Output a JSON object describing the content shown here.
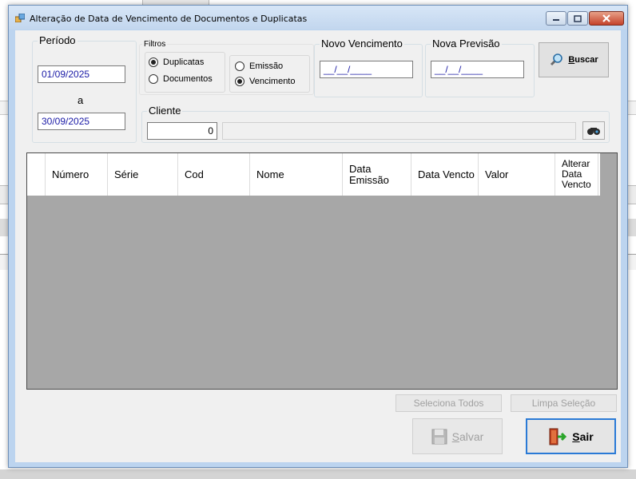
{
  "window": {
    "title": "Alteração de Data de Vencimento de Documentos e Duplicatas"
  },
  "periodo": {
    "title": "Período",
    "start_value": "01/09/2025",
    "separator": "a",
    "end_value": "30/09/2025"
  },
  "filtros": {
    "title": "Filtros",
    "options": {
      "duplicatas": "Duplicatas",
      "documentos": "Documentos",
      "emissao": "Emissão",
      "vencimento": "Vencimento"
    },
    "selected": [
      "Duplicatas",
      "Vencimento"
    ]
  },
  "novo_vencimento": {
    "title": "Novo Vencimento",
    "value": "__/__/____"
  },
  "nova_previsao": {
    "title": "Nova Previsão",
    "value": "__/__/____"
  },
  "buscar": {
    "label_prefix": "",
    "label_mnemonic": "B",
    "label_rest": "uscar"
  },
  "cliente": {
    "title": "Cliente",
    "code_value": "0",
    "name_value": ""
  },
  "grid": {
    "columns": [
      "Número",
      "Série",
      "Cod",
      "Nome",
      "Data Emissão",
      "Data Vencto",
      "Valor",
      "Alterar Data Vencto"
    ],
    "rows": []
  },
  "actions": {
    "seleciona_todos": "Seleciona Todos",
    "limpa_selecao": "Limpa Seleção",
    "salvar_mnemonic": "S",
    "salvar_rest": "alvar",
    "sair_mnemonic": "S",
    "sair_rest": "air"
  },
  "colors": {
    "input_text": "#1a1aa6",
    "grid_background": "#a7a7a7",
    "close_button": "#c5422a",
    "titlebar": "#c2d6ee"
  }
}
